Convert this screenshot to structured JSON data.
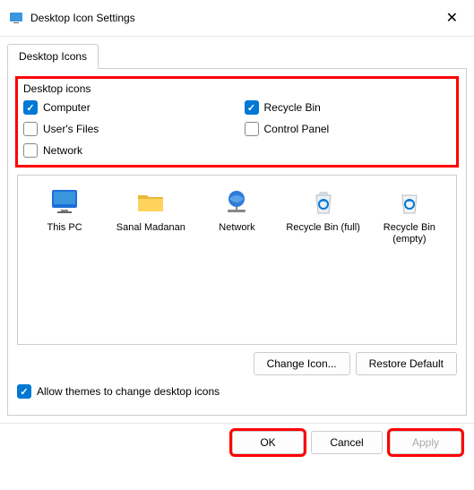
{
  "title": "Desktop Icon Settings",
  "tab": "Desktop Icons",
  "fieldset": {
    "legend": "Desktop icons",
    "checkboxes": {
      "computer": {
        "label": "Computer",
        "checked": true
      },
      "recyclebin": {
        "label": "Recycle Bin",
        "checked": true
      },
      "usersfiles": {
        "label": "User's Files",
        "checked": false
      },
      "controlpanel": {
        "label": "Control Panel",
        "checked": false
      },
      "network": {
        "label": "Network",
        "checked": false
      }
    }
  },
  "preview": {
    "items": [
      {
        "label": "This PC",
        "icon": "monitor"
      },
      {
        "label": "Sanal Madanan",
        "icon": "folder"
      },
      {
        "label": "Network",
        "icon": "network"
      },
      {
        "label": "Recycle Bin (full)",
        "icon": "bin-full"
      },
      {
        "label": "Recycle Bin (empty)",
        "icon": "bin-empty"
      }
    ]
  },
  "buttons": {
    "changeIcon": "Change Icon...",
    "restoreDefault": "Restore Default",
    "allowThemes": "Allow themes to change desktop icons",
    "ok": "OK",
    "cancel": "Cancel",
    "apply": "Apply"
  },
  "allowThemesChecked": true
}
